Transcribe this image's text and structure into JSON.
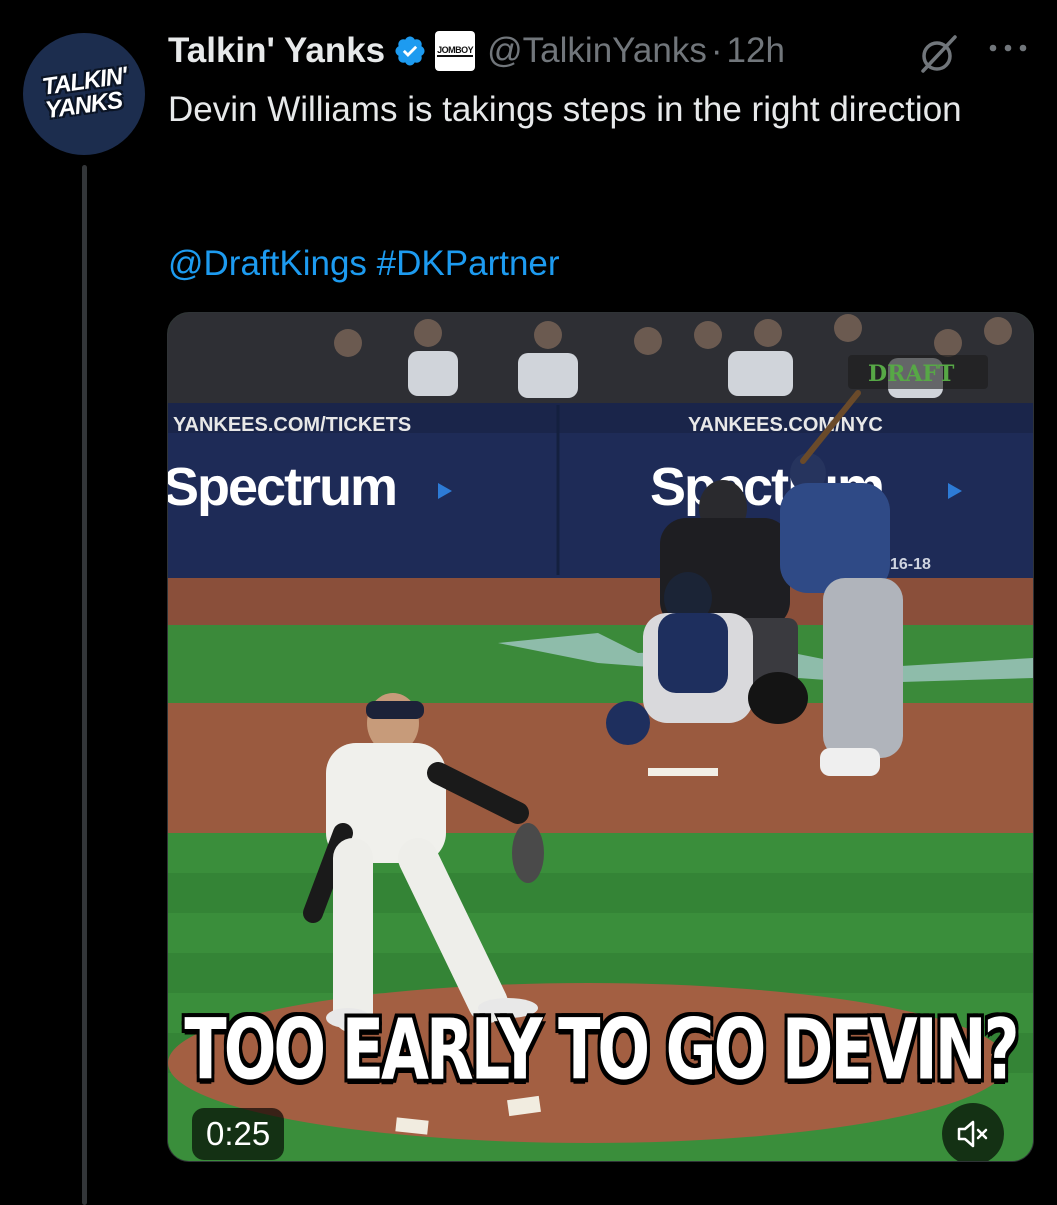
{
  "author": {
    "avatar_line1": "TALKIN'",
    "avatar_line2": "YANKS",
    "display_name": "Talkin' Yanks",
    "affiliate_badge": "JOMBOY",
    "handle": "@TalkinYanks",
    "separator": "·",
    "time": "12h"
  },
  "tweet": {
    "text": "Devin Williams is takings steps in the right direction",
    "mention": "@DraftKings",
    "hashtag": "#DKPartner"
  },
  "media": {
    "banner_left_url": "YANKEES.COM/TICKETS",
    "banner_right_url": "YANKEES.COM/NYC",
    "banner_brand_left": "Spectrum",
    "banner_brand_right": "Spectrum",
    "sponsor_logo": "DRAFT",
    "banner_date": "16-18",
    "caption": "TOO EARLY TO GO DEVIN?",
    "duration": "0:25"
  },
  "icons": {
    "verified": "verified-badge-icon",
    "grok": "grok-icon",
    "more": "more-icon",
    "mute": "volume-muted-icon"
  },
  "colors": {
    "background": "#000000",
    "text": "#e7e9ea",
    "secondary": "#71767b",
    "link": "#1d9bf0"
  }
}
